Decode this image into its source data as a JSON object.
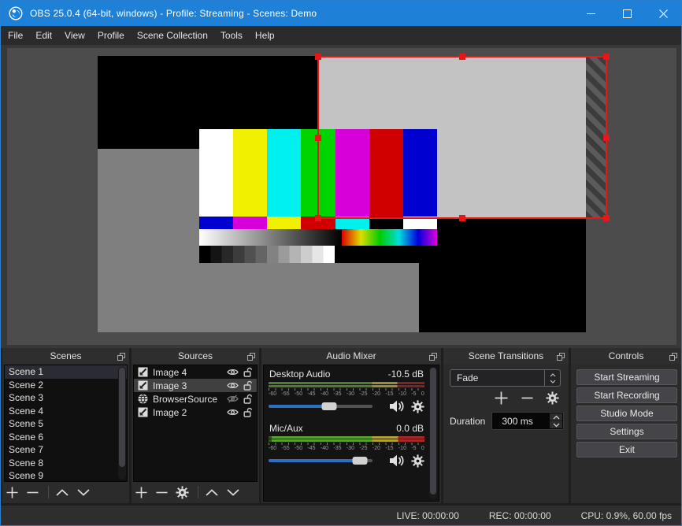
{
  "window": {
    "title": "OBS 25.0.4 (64-bit, windows) - Profile: Streaming - Scenes: Demo"
  },
  "menu": {
    "items": [
      "File",
      "Edit",
      "View",
      "Profile",
      "Scene Collection",
      "Tools",
      "Help"
    ]
  },
  "panels": {
    "scenes": {
      "title": "Scenes",
      "items": [
        "Scene 1",
        "Scene 2",
        "Scene 3",
        "Scene 4",
        "Scene 5",
        "Scene 6",
        "Scene 7",
        "Scene 8",
        "Scene 9"
      ],
      "selected": "Scene 1"
    },
    "sources": {
      "title": "Sources",
      "items": [
        {
          "name": "Image 4",
          "icon": "image",
          "visible": true,
          "locked": false,
          "selected": false
        },
        {
          "name": "Image 3",
          "icon": "image",
          "visible": true,
          "locked": false,
          "selected": true
        },
        {
          "name": "BrowserSource",
          "icon": "browser",
          "visible": false,
          "locked": false,
          "selected": false
        },
        {
          "name": "Image 2",
          "icon": "image",
          "visible": true,
          "locked": false,
          "selected": false
        }
      ]
    },
    "mixer": {
      "title": "Audio Mixer",
      "ticks": [
        "-60",
        "-55",
        "-50",
        "-45",
        "-40",
        "-35",
        "-30",
        "-25",
        "-20",
        "-15",
        "-10",
        "-5",
        "0"
      ],
      "channels": [
        {
          "name": "Desktop Audio",
          "level": "-10.5 dB",
          "volume_percent": 58
        },
        {
          "name": "Mic/Aux",
          "level": "0.0 dB",
          "volume_percent": 88
        }
      ]
    },
    "transitions": {
      "title": "Scene Transitions",
      "selected_transition": "Fade",
      "duration_label": "Duration",
      "duration_value": "300 ms"
    },
    "controls": {
      "title": "Controls",
      "buttons": [
        "Start Streaming",
        "Start Recording",
        "Studio Mode",
        "Settings",
        "Exit"
      ]
    }
  },
  "statusbar": {
    "live": "LIVE: 00:00:00",
    "rec": "REC: 00:00:00",
    "cpu": "CPU: 0.9%, 60.00 fps"
  },
  "colors": {
    "titlebar": "#1f80d7",
    "selection_red": "#e81616",
    "slider_blue": "#2e6fbe",
    "preview_background": "#4c4c4c",
    "panel_background": "#2b2b2b",
    "smpte_bars_row1": [
      "#ffffff",
      "#f0f000",
      "#00f0f0",
      "#00d400",
      "#d800d8",
      "#d00000",
      "#0000d0"
    ],
    "smpte_bars_row2": [
      "#0000d0",
      "#d800d8",
      "#f0f000",
      "#d00000",
      "#00f0f0",
      "#000000",
      "#ffffff"
    ]
  }
}
